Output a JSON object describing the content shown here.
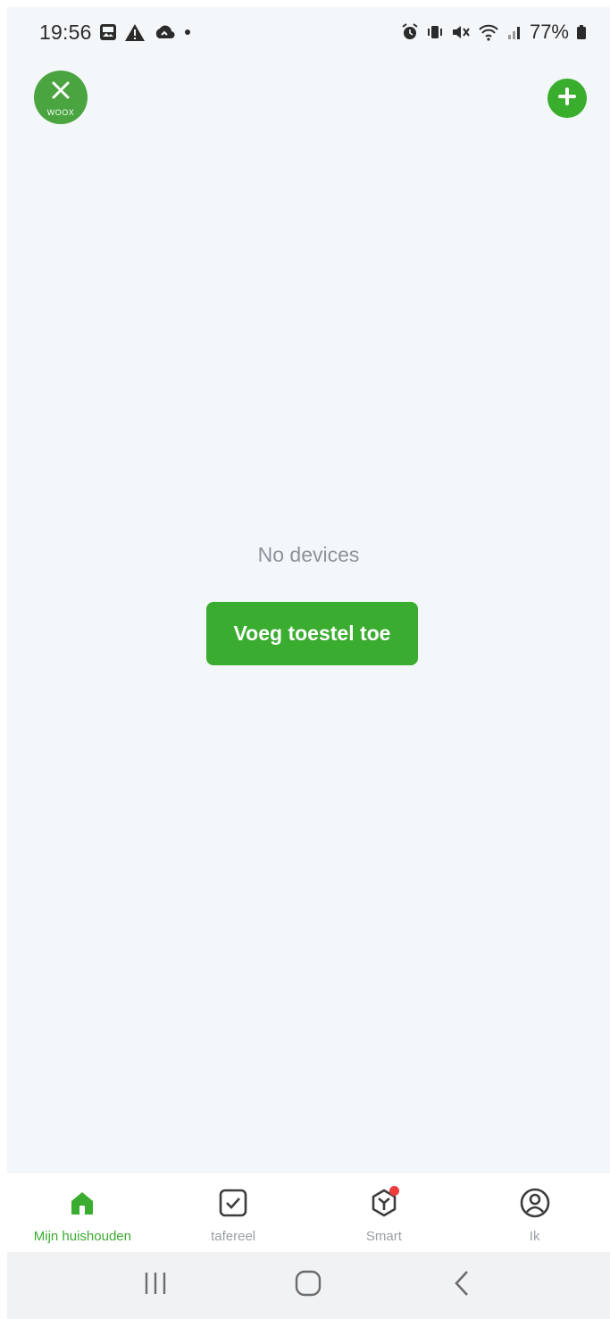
{
  "status_bar": {
    "time": "19:56",
    "battery": "77%",
    "left_icons": [
      "gallery-icon",
      "warning-icon",
      "cloud-icon",
      "dot-icon"
    ],
    "right_icons": [
      "alarm-icon",
      "vibrate-icon",
      "mute-icon",
      "wifi-icon",
      "signal-icon",
      "battery-icon"
    ]
  },
  "header": {
    "logo_text": "WOOX",
    "add_icon": "plus-circle-icon"
  },
  "main": {
    "empty_text": "No devices",
    "add_device_label": "Voeg toestel toe"
  },
  "bottom_nav": {
    "items": [
      {
        "label": "Mijn huishouden",
        "icon": "home-icon",
        "active": true
      },
      {
        "label": "tafereel",
        "icon": "scene-check-icon",
        "active": false
      },
      {
        "label": "Smart",
        "icon": "smart-icon",
        "active": false,
        "badge": true
      },
      {
        "label": "Ik",
        "icon": "profile-icon",
        "active": false
      }
    ]
  },
  "system_nav": [
    "recents-icon",
    "home-outline-icon",
    "back-icon"
  ],
  "colors": {
    "accent": "#3aac2f",
    "background": "#f4f7fa",
    "badge": "#ee3b3b",
    "muted_text": "#8d9299"
  }
}
